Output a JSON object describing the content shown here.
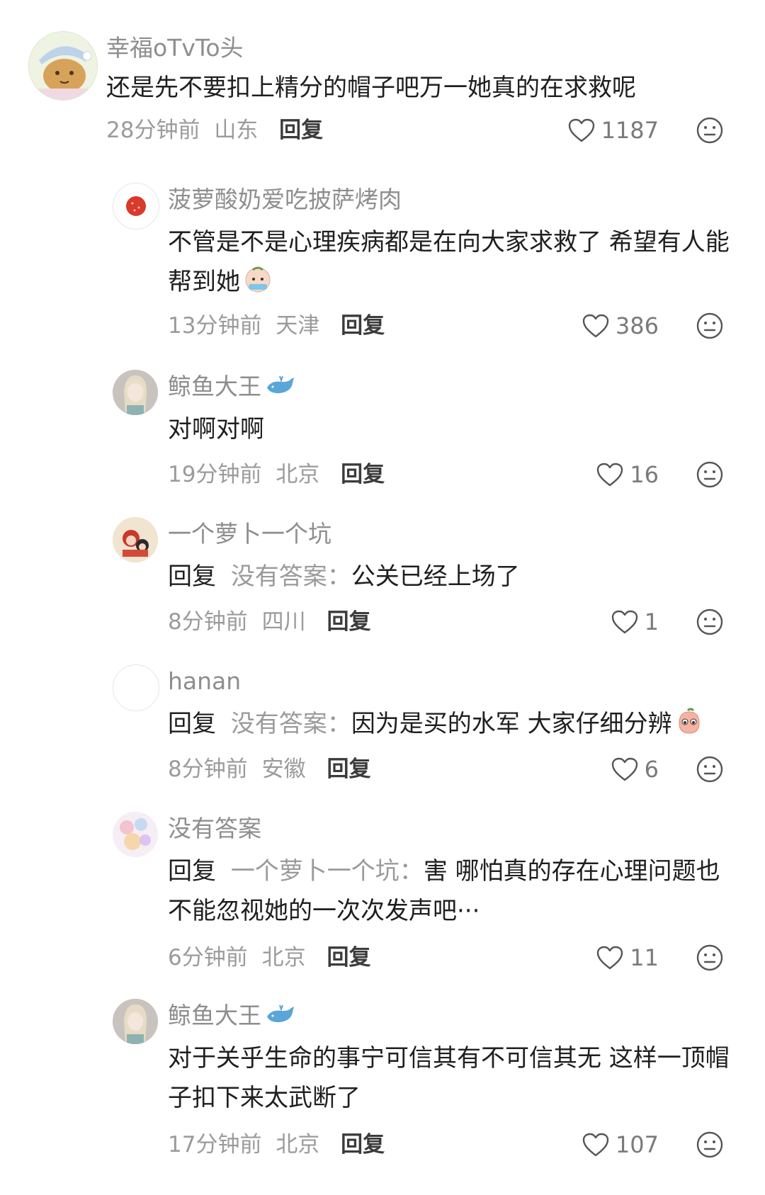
{
  "comments": [
    {
      "user": "幸福oTvTo头",
      "text": "还是先不要扣上精分的帽子吧万一她真的在求救呢",
      "time": "28分钟前",
      "location": "山东",
      "reply_label": "回复",
      "likes": "1187"
    },
    {
      "user": "菠萝酸奶爱吃披萨烤肉",
      "text": "不管是不是心理疾病都是在向大家求救了 希望有人能帮到她",
      "emoji": "crying-face-sticker",
      "time": "13分钟前",
      "location": "天津",
      "reply_label": "回复",
      "likes": "386"
    },
    {
      "user": "鲸鱼大王",
      "user_badge": "whale-icon",
      "text": "对啊对啊",
      "time": "19分钟前",
      "location": "北京",
      "reply_label": "回复",
      "likes": "16"
    },
    {
      "user": "一个萝卜一个坑",
      "reply_prefix": "回复",
      "reply_to": "没有答案：",
      "text": "公关已经上场了",
      "time": "8分钟前",
      "location": "四川",
      "reply_label": "回复",
      "likes": "1"
    },
    {
      "user": "hanan",
      "reply_prefix": "回复",
      "reply_to": "没有答案：",
      "text": "因为是买的水军 大家仔细分辨",
      "emoji": "peach-pleading-sticker",
      "time": "8分钟前",
      "location": "安徽",
      "reply_label": "回复",
      "likes": "6"
    },
    {
      "user": "没有答案",
      "reply_prefix": "回复",
      "reply_to": "一个萝卜一个坑：",
      "text": "害 哪怕真的存在心理问题也不能忽视她的一次次发声吧···",
      "time": "6分钟前",
      "location": "北京",
      "reply_label": "回复",
      "likes": "11"
    },
    {
      "user": "鲸鱼大王",
      "user_badge": "whale-icon",
      "text": "对于关乎生命的事宁可信其有不可信其无 这样一顶帽子扣下来太武断了",
      "time": "17分钟前",
      "location": "北京",
      "reply_label": "回复",
      "likes": "107"
    }
  ],
  "colors": {
    "name": "#8e8e8e",
    "body_text": "#1f1f1f",
    "meta": "#9b9b9b",
    "reply_target": "#9a9a9a",
    "icon": "#555555"
  }
}
